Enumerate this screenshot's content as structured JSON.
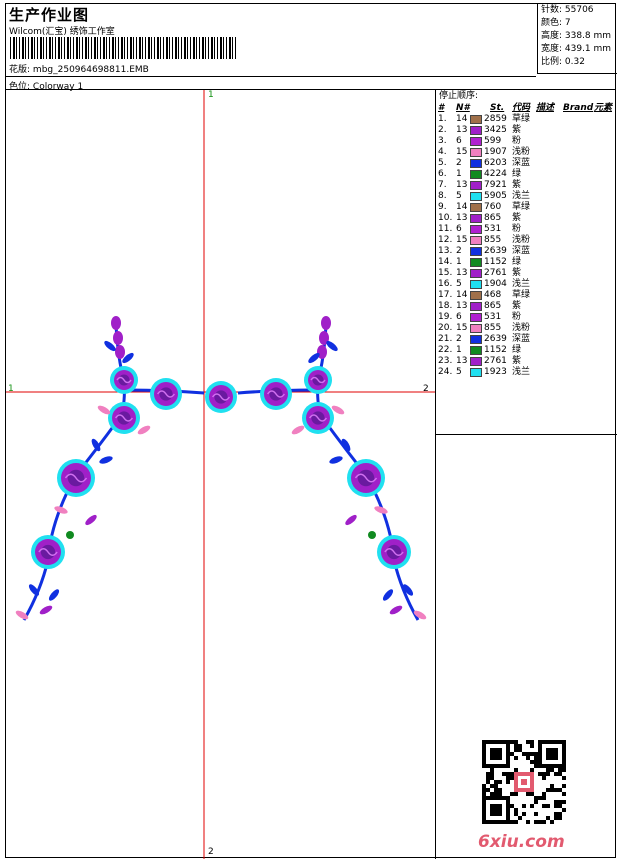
{
  "header": {
    "title": "生产作业图",
    "studio": "Wilcom(汇宝) 绣饰工作室",
    "design_label": "花版:",
    "design_file": "mbg_250964698811.EMB",
    "colorway_label": "色位:",
    "colorway": "Colorway 1"
  },
  "specs": {
    "stitches": "针数: 55706",
    "colors": "颜色: 7",
    "height": "高度: 338.8 mm",
    "width": "宽度: 439.1 mm",
    "scale": "比例: 0.32"
  },
  "axes": {
    "top": "1",
    "bottom": "2",
    "left": "1",
    "right": "2"
  },
  "stop_panel": {
    "title": "停止顺序:",
    "headers": {
      "idx": "#",
      "needle": "N#",
      "st": "St.",
      "code": "代码",
      "desc": "描述",
      "brand": "Brand",
      "elem": "元素"
    }
  },
  "stops": [
    {
      "idx": "1.",
      "needle": "14",
      "st": "2859",
      "code": "草绿",
      "color": "#a0704a"
    },
    {
      "idx": "2.",
      "needle": "13",
      "st": "3425",
      "code": "紫",
      "color": "#a020c8"
    },
    {
      "idx": "3.",
      "needle": "6",
      "st": "599",
      "code": "粉",
      "color": "#b020d0"
    },
    {
      "idx": "4.",
      "needle": "15",
      "st": "1907",
      "code": "浅粉",
      "color": "#f080c0"
    },
    {
      "idx": "5.",
      "needle": "2",
      "st": "6203",
      "code": "深蓝",
      "color": "#1030e0"
    },
    {
      "idx": "6.",
      "needle": "1",
      "st": "4224",
      "code": "绿",
      "color": "#108a20"
    },
    {
      "idx": "7.",
      "needle": "13",
      "st": "7921",
      "code": "紫",
      "color": "#a020c8"
    },
    {
      "idx": "8.",
      "needle": "5",
      "st": "5905",
      "code": "浅兰",
      "color": "#20e0f0"
    },
    {
      "idx": "9.",
      "needle": "14",
      "st": "760",
      "code": "草绿",
      "color": "#a0704a"
    },
    {
      "idx": "10.",
      "needle": "13",
      "st": "865",
      "code": "紫",
      "color": "#a020c8"
    },
    {
      "idx": "11.",
      "needle": "6",
      "st": "531",
      "code": "粉",
      "color": "#b020d0"
    },
    {
      "idx": "12.",
      "needle": "15",
      "st": "855",
      "code": "浅粉",
      "color": "#f080c0"
    },
    {
      "idx": "13.",
      "needle": "2",
      "st": "2639",
      "code": "深蓝",
      "color": "#1030e0"
    },
    {
      "idx": "14.",
      "needle": "1",
      "st": "1152",
      "code": "绿",
      "color": "#108a20"
    },
    {
      "idx": "15.",
      "needle": "13",
      "st": "2761",
      "code": "紫",
      "color": "#a020c8"
    },
    {
      "idx": "16.",
      "needle": "5",
      "st": "1904",
      "code": "浅兰",
      "color": "#20e0f0"
    },
    {
      "idx": "17.",
      "needle": "14",
      "st": "468",
      "code": "草绿",
      "color": "#a0704a"
    },
    {
      "idx": "18.",
      "needle": "13",
      "st": "865",
      "code": "紫",
      "color": "#a020c8"
    },
    {
      "idx": "19.",
      "needle": "6",
      "st": "531",
      "code": "粉",
      "color": "#b020d0"
    },
    {
      "idx": "20.",
      "needle": "15",
      "st": "855",
      "code": "浅粉",
      "color": "#f080c0"
    },
    {
      "idx": "21.",
      "needle": "2",
      "st": "2639",
      "code": "深蓝",
      "color": "#1030e0"
    },
    {
      "idx": "22.",
      "needle": "1",
      "st": "1152",
      "code": "绿",
      "color": "#108a20"
    },
    {
      "idx": "23.",
      "needle": "13",
      "st": "2761",
      "code": "紫",
      "color": "#a020c8"
    },
    {
      "idx": "24.",
      "needle": "5",
      "st": "1923",
      "code": "浅兰",
      "color": "#20e0f0"
    }
  ],
  "watermark": "6xiu.com",
  "icons": {
    "barcode": "barcode-icon",
    "qr": "qr-code-icon"
  }
}
